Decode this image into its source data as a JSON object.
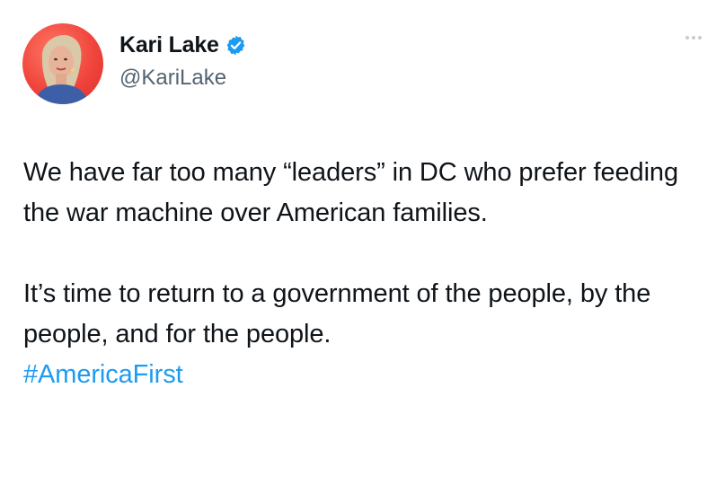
{
  "author": {
    "display_name": "Kari Lake",
    "handle": "@KariLake",
    "verified_badge_icon": "verified-badge-icon",
    "avatar_icon": "profile-photo"
  },
  "menu": {
    "icon": "more-options-icon"
  },
  "tweet": {
    "paragraph_1": "We have far too many “leaders” in DC who prefer feeding the war machine over American families.",
    "paragraph_2": "It’s time to return to a government of the people, by the people, and for the people.",
    "hashtag": "#AmericaFirst"
  },
  "colors": {
    "text": "#0f1419",
    "secondary": "#536471",
    "link": "#1d9bf0",
    "avatar_background": "#f0453c"
  }
}
